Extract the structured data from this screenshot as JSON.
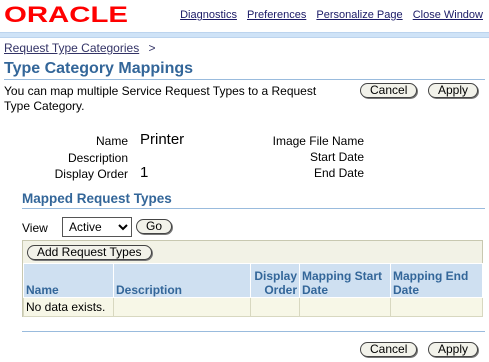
{
  "brand": {
    "logo_text": "ORACLE",
    "color": "#ff0000"
  },
  "global_links": {
    "diagnostics": "Diagnostics",
    "preferences": "Preferences",
    "personalize": "Personalize Page",
    "close": "Close Window"
  },
  "breadcrumb": {
    "link": "Request Type Categories",
    "separator": ">"
  },
  "page": {
    "title": "Type Category Mappings",
    "instruction": "You can map multiple Service Request Types to a Request Type Category."
  },
  "buttons": {
    "cancel": "Cancel",
    "apply": "Apply",
    "go": "Go",
    "add_request_types": "Add Request Types"
  },
  "details": {
    "name_label": "Name",
    "name_value": "Printer",
    "description_label": "Description",
    "description_value": "",
    "display_order_label": "Display Order",
    "display_order_value": "1",
    "image_file_label": "Image File Name",
    "image_file_value": "",
    "start_date_label": "Start Date",
    "start_date_value": "",
    "end_date_label": "End Date",
    "end_date_value": ""
  },
  "mapped": {
    "title": "Mapped Request Types",
    "view_label": "View",
    "view_selected": "Active",
    "columns": {
      "name": "Name",
      "description": "Description",
      "display_order": "Display Order",
      "start_date": "Mapping Start Date",
      "end_date": "Mapping End Date"
    },
    "empty_text": "No data exists."
  },
  "colors": {
    "heading": "#336699",
    "header_bg": "#cfe0f1",
    "table_bg": "#f2f2e6"
  }
}
